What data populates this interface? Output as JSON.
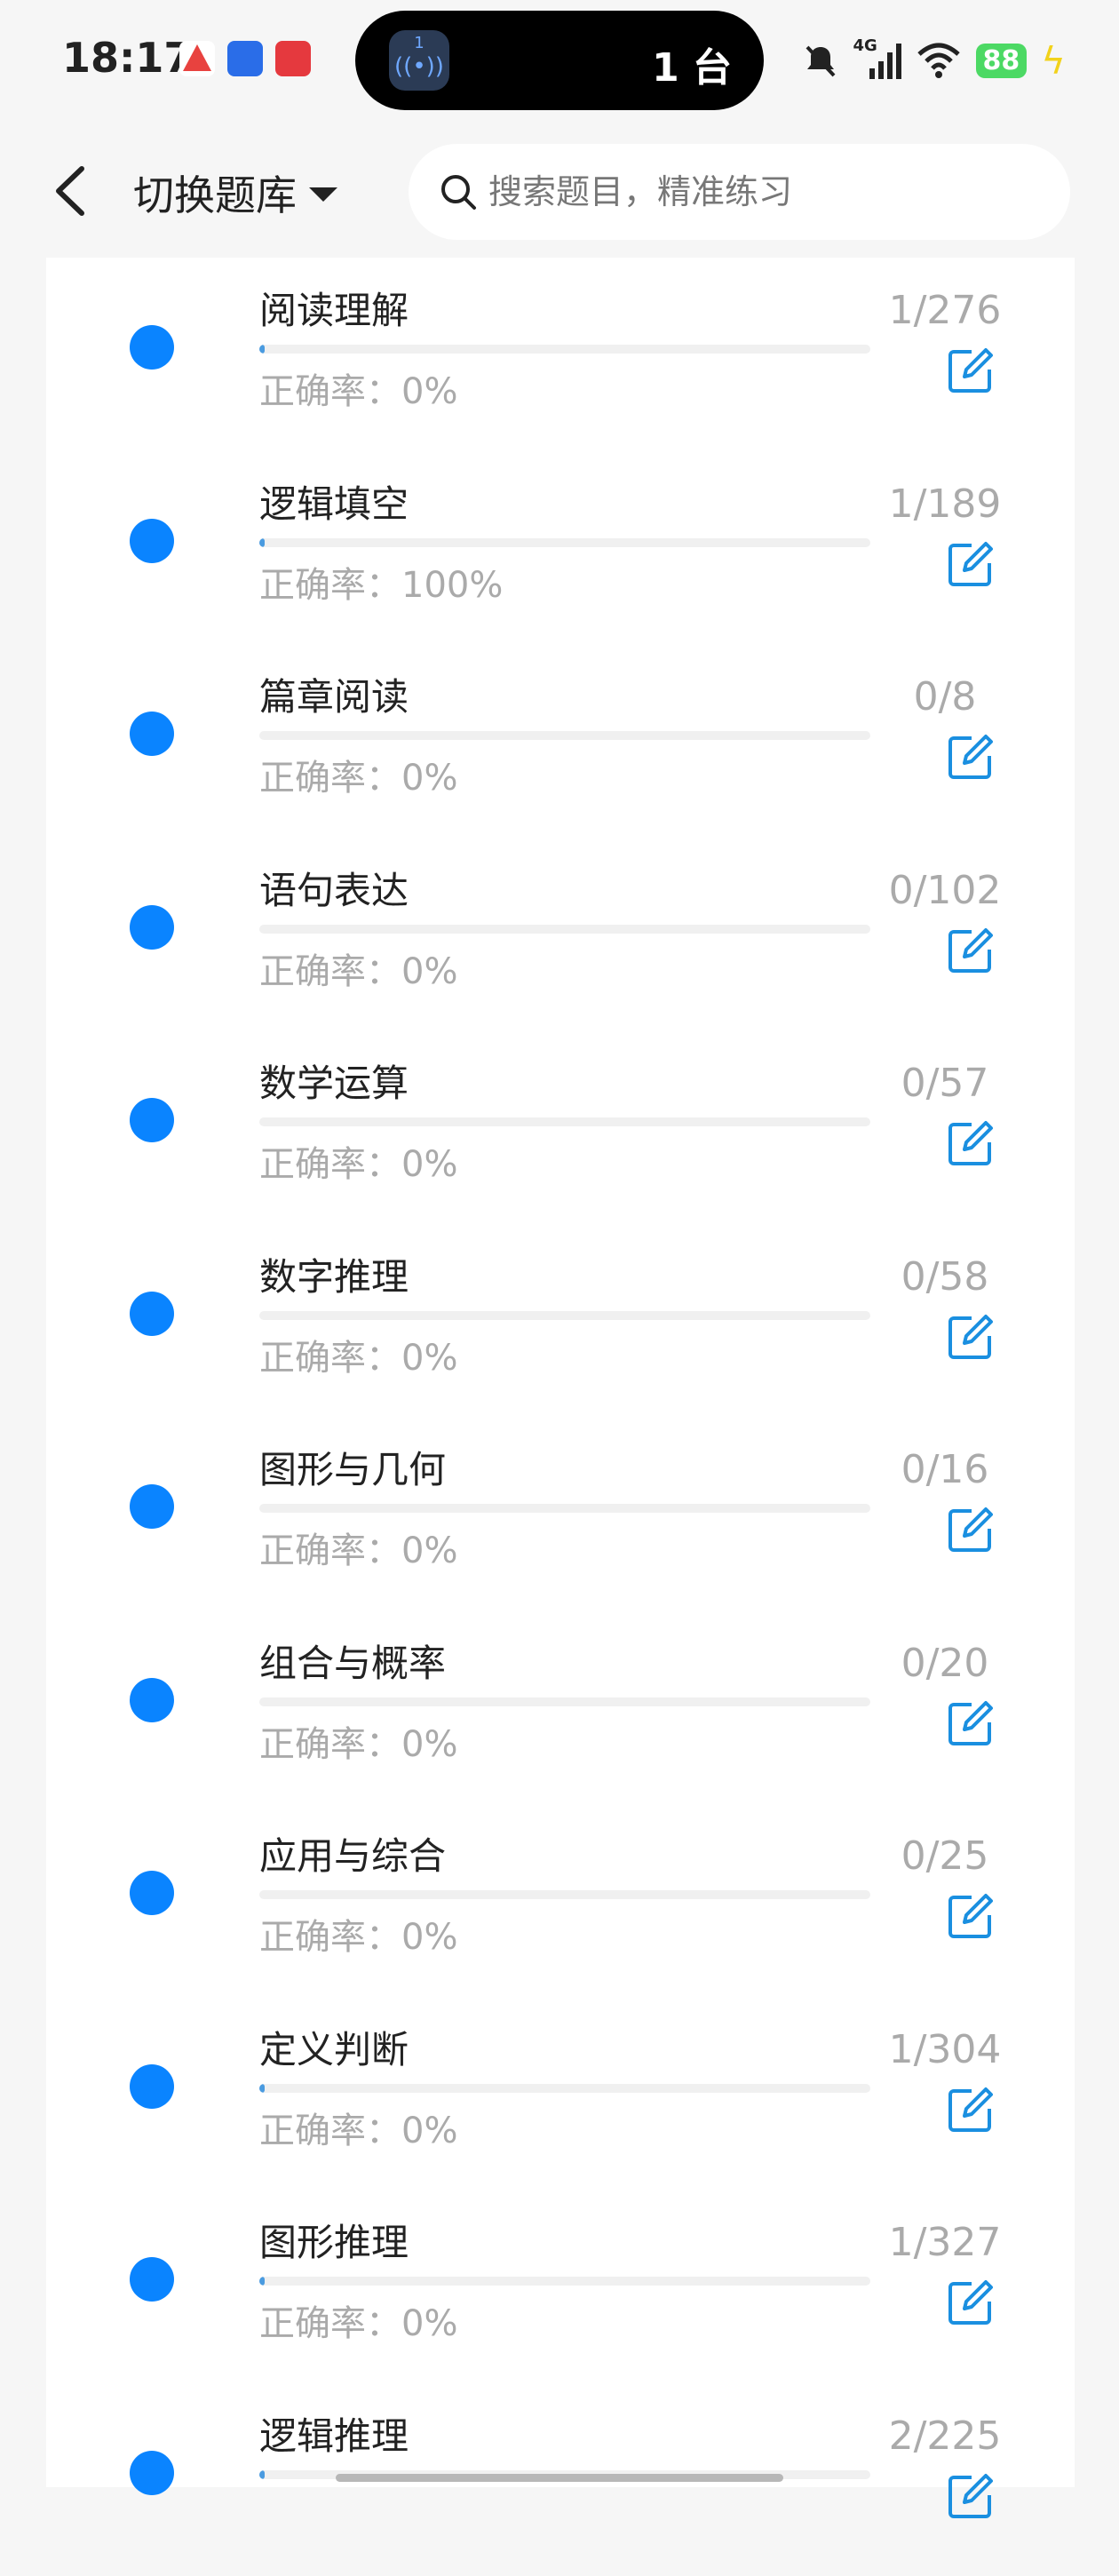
{
  "status_bar": {
    "time": "18:17",
    "island_badge_number": "1",
    "island_text": "1 台",
    "network": "4G",
    "battery": "88"
  },
  "top_bar": {
    "switch_label": "切换题库",
    "search_placeholder": "搜索题目，精准练习"
  },
  "colors": {
    "accent": "#0a84ff",
    "progress": "#4a9be0",
    "muted_text": "#aaaaaa"
  },
  "items": [
    {
      "title": "阅读理解",
      "count": "1/276",
      "rate": "正确率：0%",
      "progress": 0.0036
    },
    {
      "title": "逻辑填空",
      "count": "1/189",
      "rate": "正确率：100%",
      "progress": 0.0053
    },
    {
      "title": "篇章阅读",
      "count": "0/8",
      "rate": "正确率：0%",
      "progress": 0
    },
    {
      "title": "语句表达",
      "count": "0/102",
      "rate": "正确率：0%",
      "progress": 0
    },
    {
      "title": "数学运算",
      "count": "0/57",
      "rate": "正确率：0%",
      "progress": 0
    },
    {
      "title": "数字推理",
      "count": "0/58",
      "rate": "正确率：0%",
      "progress": 0
    },
    {
      "title": "图形与几何",
      "count": "0/16",
      "rate": "正确率：0%",
      "progress": 0
    },
    {
      "title": "组合与概率",
      "count": "0/20",
      "rate": "正确率：0%",
      "progress": 0
    },
    {
      "title": "应用与综合",
      "count": "0/25",
      "rate": "正确率：0%",
      "progress": 0
    },
    {
      "title": "定义判断",
      "count": "1/304",
      "rate": "正确率：0%",
      "progress": 0.0033
    },
    {
      "title": "图形推理",
      "count": "1/327",
      "rate": "正确率：0%",
      "progress": 0.0031
    },
    {
      "title": "逻辑推理",
      "count": "2/225",
      "rate": "",
      "progress": 0.0089
    }
  ]
}
